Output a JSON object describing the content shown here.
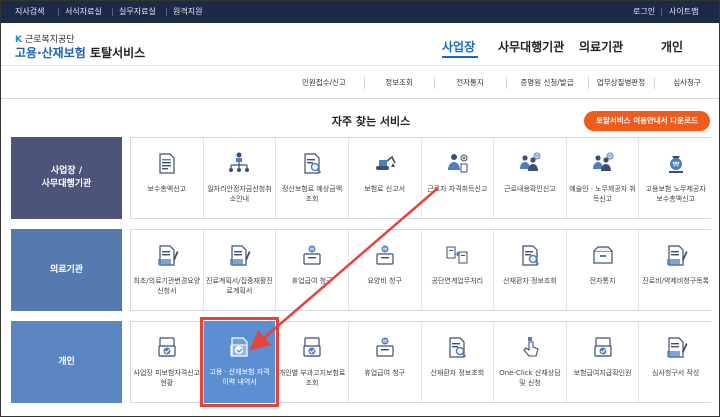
{
  "topbar": {
    "links": [
      "지사검색",
      "서식자료실",
      "실무자료실",
      "원격지원"
    ],
    "right": [
      "로그인",
      "사이트맵"
    ]
  },
  "logo": {
    "sub": "근로복지공단",
    "main_blue": "고용·산재보험",
    "main_dark": "토탈서비스"
  },
  "mainnav": [
    "사업장",
    "사무대행기관",
    "의료기관",
    "개인"
  ],
  "subnav": [
    "민원접수/신고",
    "정보조회",
    "전자통지",
    "증명원 신청/발급",
    "업무상질병판정",
    "심사청구"
  ],
  "section_title": "자주 찾는 서비스",
  "guide_button": "토탈서비스 이용안내서 다운로드",
  "rows": [
    {
      "head_lines": [
        "사업장 /",
        "사무대행기관"
      ],
      "head_color": "#4d5479",
      "items": [
        {
          "label": "보수총액신고",
          "icon": "document-list-icon"
        },
        {
          "label": "일자리안정자금신청취소안내",
          "icon": "org-chart-icon"
        },
        {
          "label": "정산보험료 예상금액 조회",
          "icon": "document-search-icon"
        },
        {
          "label": "보험료 신고서",
          "icon": "excavator-icon"
        },
        {
          "label": "근로자 자격취득신고",
          "icon": "person-plus-icon"
        },
        {
          "label": "근로내용확인신고",
          "icon": "people-coin-icon"
        },
        {
          "label": "예술인ㆍ노무제공자 취득신고",
          "icon": "people-coin-icon"
        },
        {
          "label": "고용보험 노무제공자 보수총액신고",
          "icon": "money-bag-icon"
        }
      ]
    },
    {
      "head_lines": [
        "의료기관"
      ],
      "head_color": "#5679b0",
      "items": [
        {
          "label": "최초/의료기관변경요양신청서",
          "icon": "document-pen-icon"
        },
        {
          "label": "진료계획서/집중재활진료계획서",
          "icon": "document-pen-icon"
        },
        {
          "label": "휴업급여 청구",
          "icon": "coin-box-icon"
        },
        {
          "label": "요양비 청구",
          "icon": "coin-box-icon"
        },
        {
          "label": "공단연계업무처리",
          "icon": "document-exchange-icon"
        },
        {
          "label": "산재환자 정보조회",
          "icon": "document-search-icon"
        },
        {
          "label": "전자통지",
          "icon": "box-icon"
        },
        {
          "label": "진료비/약제비청구목록",
          "icon": "document-pen-icon"
        }
      ]
    },
    {
      "head_lines": [
        "개인"
      ],
      "head_color": "#5c86c2",
      "items": [
        {
          "label": "사업장 피보험자격신고현황",
          "icon": "document-check-icon"
        },
        {
          "label": "고용ㆍ산재보험 자격 이력 내역서",
          "icon": "document-check-icon"
        },
        {
          "label": "개인별 부과고지보험료 조회",
          "icon": "document-check-icon"
        },
        {
          "label": "휴업급여 청구",
          "icon": "coin-box-icon"
        },
        {
          "label": "산재환자 정보조회",
          "icon": "document-search-icon"
        },
        {
          "label": "One-Click 산재상담 및 신청",
          "icon": "hand-click-icon"
        },
        {
          "label": "보험급여지급확인원",
          "icon": "document-check-icon"
        },
        {
          "label": "심사청구서 작성",
          "icon": "document-pen-icon"
        }
      ]
    }
  ],
  "colors": {
    "topbar": "#1c2a47",
    "accent": "#1769c9",
    "orange": "#f05a1a",
    "highlight": "#5b8fd1",
    "annotation": "#e8423b"
  }
}
